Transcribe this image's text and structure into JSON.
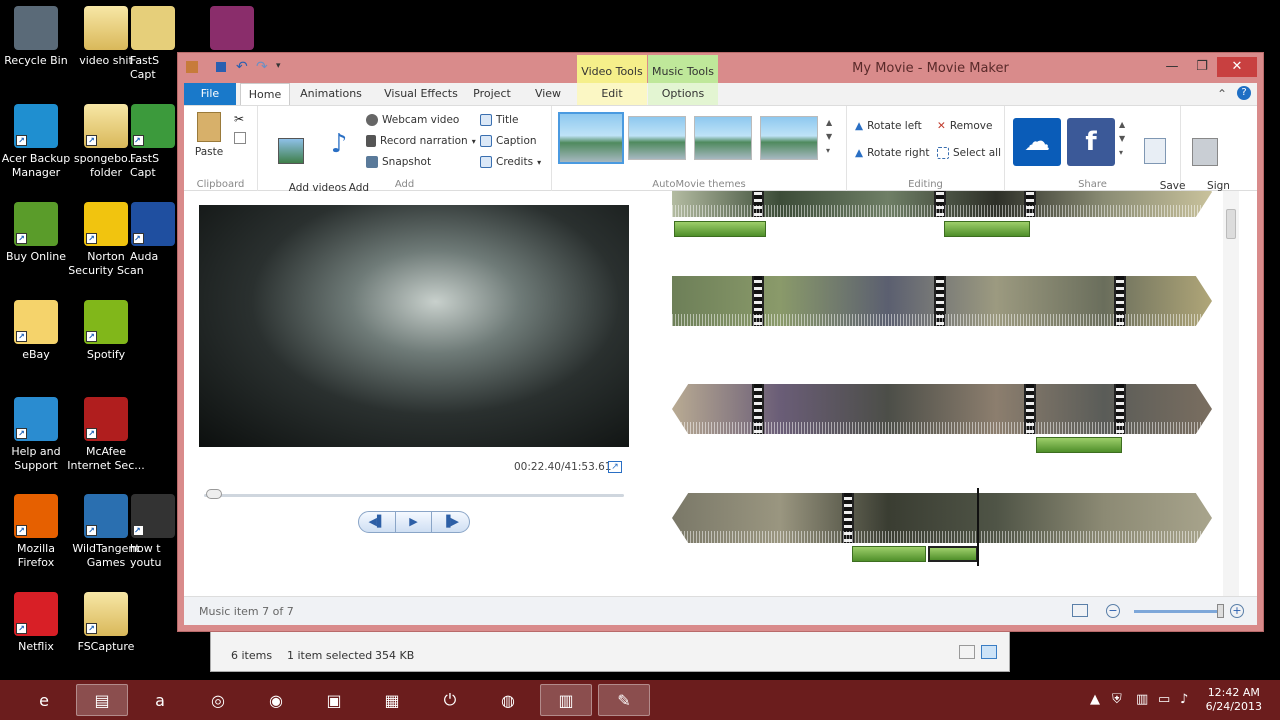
{
  "desktop": {
    "icons": [
      {
        "label": "Recycle Bin",
        "icon": "recycle-bin-icon",
        "color": "#5a6a78"
      },
      {
        "label": "video shit",
        "icon": "folder-icon",
        "color": "#e6cf7a"
      },
      {
        "label": "FastS\nCapt",
        "icon": "fastscreen-icon",
        "color": "#e6cf7a"
      },
      {
        "label": "",
        "icon": "winrar-icon",
        "color": "#8a2d6b"
      },
      {
        "label": "Acer Backup\nManager",
        "icon": "acer-backup-icon",
        "color": "#1f8fd0"
      },
      {
        "label": "spongebo...\nfolder",
        "icon": "folder-icon",
        "color": "#e6cf7a"
      },
      {
        "label": "FastS\nCapt",
        "icon": "fastscreen-icon",
        "color": "#3c9a3c"
      },
      {
        "label": "Buy Online",
        "icon": "acer-bag-icon",
        "color": "#5a9c2a"
      },
      {
        "label": "Norton\nSecurity Scan",
        "icon": "norton-icon",
        "color": "#f1c40f"
      },
      {
        "label": "Auda",
        "icon": "audacity-icon",
        "color": "#1f4fa0"
      },
      {
        "label": "eBay",
        "icon": "ebay-icon",
        "color": "#f5d36b"
      },
      {
        "label": "Spotify",
        "icon": "spotify-icon",
        "color": "#81b71a"
      },
      {
        "label": "Help and\nSupport",
        "icon": "help-icon",
        "color": "#2a8cd0"
      },
      {
        "label": "McAfee\nInternet Sec...",
        "icon": "mcafee-icon",
        "color": "#b01e1e"
      },
      {
        "label": "Mozilla\nFirefox",
        "icon": "firefox-icon",
        "color": "#e66000"
      },
      {
        "label": "WildTangent\nGames",
        "icon": "wildtangent-icon",
        "color": "#2a6fb0"
      },
      {
        "label": "how t\nyoutu",
        "icon": "video-file-icon",
        "color": "#333333"
      },
      {
        "label": "Netflix",
        "icon": "netflix-icon",
        "color": "#d81f26"
      },
      {
        "label": "FSCapture",
        "icon": "folder-icon",
        "color": "#e6cf7a"
      }
    ]
  },
  "explorer": {
    "items_count": "6 items",
    "selection": "1 item selected",
    "size": "354 KB"
  },
  "window": {
    "title": "My Movie - Movie Maker",
    "context_tabs": [
      {
        "group": "Video Tools",
        "tab": "Edit",
        "color": "#f5ef8a"
      },
      {
        "group": "Music Tools",
        "tab": "Options",
        "color": "#bfe89a"
      }
    ],
    "tabs": [
      "File",
      "Home",
      "Animations",
      "Visual Effects",
      "Project",
      "View"
    ],
    "quick_access": [
      "save-icon",
      "undo-icon",
      "redo-icon"
    ]
  },
  "ribbon": {
    "clipboard": {
      "label": "Clipboard",
      "paste": "Paste"
    },
    "add": {
      "label": "Add",
      "add_videos": "Add videos\nand photos",
      "add_music": "Add\nmusic",
      "webcam": "Webcam video",
      "record": "Record narration",
      "snapshot": "Snapshot",
      "title": "Title",
      "caption": "Caption",
      "credits": "Credits"
    },
    "themes": {
      "label": "AutoMovie themes"
    },
    "editing": {
      "label": "Editing",
      "rotate_left": "Rotate left",
      "rotate_right": "Rotate right",
      "remove": "Remove",
      "select_all": "Select all"
    },
    "share": {
      "label": "Share",
      "save_movie": "Save\nmovie"
    },
    "sign_in": "Sign\nin"
  },
  "preview": {
    "timecode": "00:22.40/41:53.61",
    "progress": 0.009
  },
  "status": {
    "text": "Music item 7 of 7",
    "zoom": 0.98
  },
  "taskbar": {
    "items": [
      "ie-icon",
      "explorer-icon",
      "amazon-icon",
      "camera-app-icon",
      "speaker-app-icon",
      "doc-app-icon",
      "office-app-icon",
      "power-app-icon",
      "firefox-icon",
      "winrar-icon",
      "moviemaker-icon"
    ],
    "time": "12:42 AM",
    "date": "6/24/2013"
  }
}
